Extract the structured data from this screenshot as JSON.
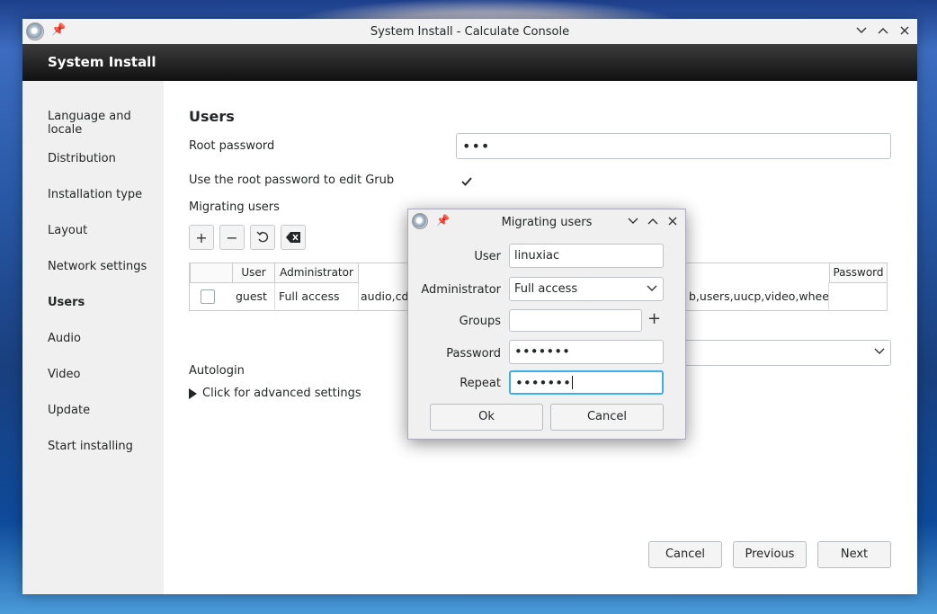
{
  "window": {
    "title": "System Install - Calculate Console",
    "header": "System Install"
  },
  "sidebar": {
    "items": [
      {
        "label": "Language and locale"
      },
      {
        "label": "Distribution"
      },
      {
        "label": "Installation type"
      },
      {
        "label": "Layout"
      },
      {
        "label": "Network settings"
      },
      {
        "label": "Users"
      },
      {
        "label": "Audio"
      },
      {
        "label": "Video"
      },
      {
        "label": "Update"
      },
      {
        "label": "Start installing"
      }
    ]
  },
  "main": {
    "section_title": "Users",
    "root_password_label": "Root password",
    "root_password_value": "•••",
    "grub_label": "Use the root password to edit Grub",
    "grub_checked": true,
    "migrating_label": "Migrating users",
    "table": {
      "headers": [
        "User",
        "Administrator",
        "Password"
      ],
      "rows": [
        {
          "user": "guest",
          "admin": "Full access",
          "groups_start": "audio,cdr",
          "groups_end": "b,users,uucp,video,wheel"
        }
      ]
    },
    "autologin_label": "Autologin",
    "advanced_label": "Click for advanced settings",
    "buttons": {
      "cancel": "Cancel",
      "previous": "Previous",
      "next": "Next"
    }
  },
  "dialog": {
    "title": "Migrating users",
    "user_label": "User",
    "user_value": "linuxiac",
    "admin_label": "Administrator",
    "admin_value": "Full access",
    "groups_label": "Groups",
    "groups_value": "",
    "password_label": "Password",
    "password_value": "•••••••",
    "repeat_label": "Repeat",
    "repeat_value": "•••••••",
    "ok_label": "Ok",
    "cancel_label": "Cancel"
  }
}
